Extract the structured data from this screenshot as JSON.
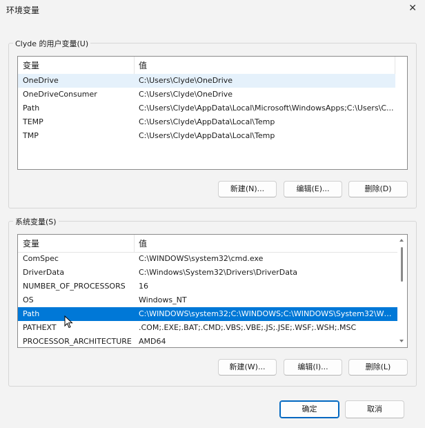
{
  "window": {
    "title": "环境变量",
    "close_glyph": "✕"
  },
  "user_vars": {
    "label": "Clyde 的用户变量(U)",
    "columns": [
      "变量",
      "值"
    ],
    "rows": [
      {
        "name": "OneDrive",
        "value": "C:\\Users\\Clyde\\OneDrive"
      },
      {
        "name": "OneDriveConsumer",
        "value": "C:\\Users\\Clyde\\OneDrive"
      },
      {
        "name": "Path",
        "value": "C:\\Users\\Clyde\\AppData\\Local\\Microsoft\\WindowsApps;C:\\Users\\C..."
      },
      {
        "name": "TEMP",
        "value": "C:\\Users\\Clyde\\AppData\\Local\\Temp"
      },
      {
        "name": "TMP",
        "value": "C:\\Users\\Clyde\\AppData\\Local\\Temp"
      }
    ],
    "buttons": {
      "new": "新建(N)...",
      "edit": "编辑(E)...",
      "delete": "删除(D)"
    }
  },
  "system_vars": {
    "label": "系统变量(S)",
    "columns": [
      "变量",
      "值"
    ],
    "rows": [
      {
        "name": "ComSpec",
        "value": "C:\\WINDOWS\\system32\\cmd.exe"
      },
      {
        "name": "DriverData",
        "value": "C:\\Windows\\System32\\Drivers\\DriverData"
      },
      {
        "name": "NUMBER_OF_PROCESSORS",
        "value": "16"
      },
      {
        "name": "OS",
        "value": "Windows_NT"
      },
      {
        "name": "Path",
        "value": "C:\\WINDOWS\\system32;C:\\WINDOWS;C:\\WINDOWS\\System32\\Wb..."
      },
      {
        "name": "PATHEXT",
        "value": ".COM;.EXE;.BAT;.CMD;.VBS;.VBE;.JS;.JSE;.WSF;.WSH;.MSC"
      },
      {
        "name": "PROCESSOR_ARCHITECTURE",
        "value": "AMD64"
      }
    ],
    "buttons": {
      "new": "新建(W)...",
      "edit": "编辑(I)...",
      "delete": "删除(L)"
    }
  },
  "footer": {
    "ok": "确定",
    "cancel": "取消"
  },
  "colors": {
    "selection": "#0078d7",
    "selection_light": "#e5f1fb",
    "primary_border": "#0067c0"
  }
}
